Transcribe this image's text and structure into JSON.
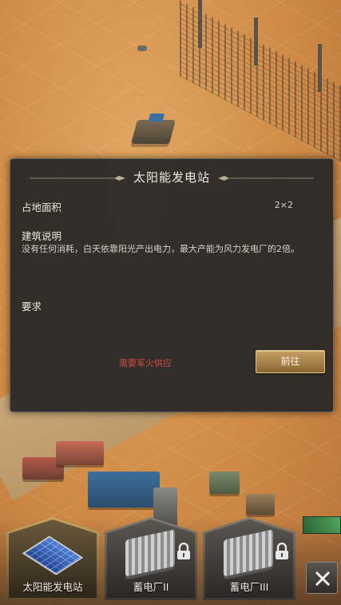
{
  "dialog": {
    "title": "太阳能发电站",
    "footprint_label": "占地面积",
    "footprint_value": "2×2",
    "desc_heading": "建筑说明",
    "desc_text": "没有任何消耗，白天依靠阳光产出电力，最大产能为风力发电厂的2倍。",
    "requirements_label": "要求",
    "requirement_note": "需要军火供应",
    "go_button": "前往"
  },
  "build_bar": {
    "items": [
      {
        "label": "太阳能发电站",
        "selected": true,
        "locked": false,
        "icon": "solar-panel-icon"
      },
      {
        "label": "蓄电厂II",
        "selected": false,
        "locked": true,
        "icon": "battery-plant-icon"
      },
      {
        "label": "蓄电厂III",
        "selected": false,
        "locked": true,
        "icon": "battery-plant-icon"
      }
    ],
    "close_icon": "close-icon"
  },
  "colors": {
    "accent_gold": "#c6a064",
    "warning_red": "#d24b42",
    "panel_bg": "#262626"
  }
}
